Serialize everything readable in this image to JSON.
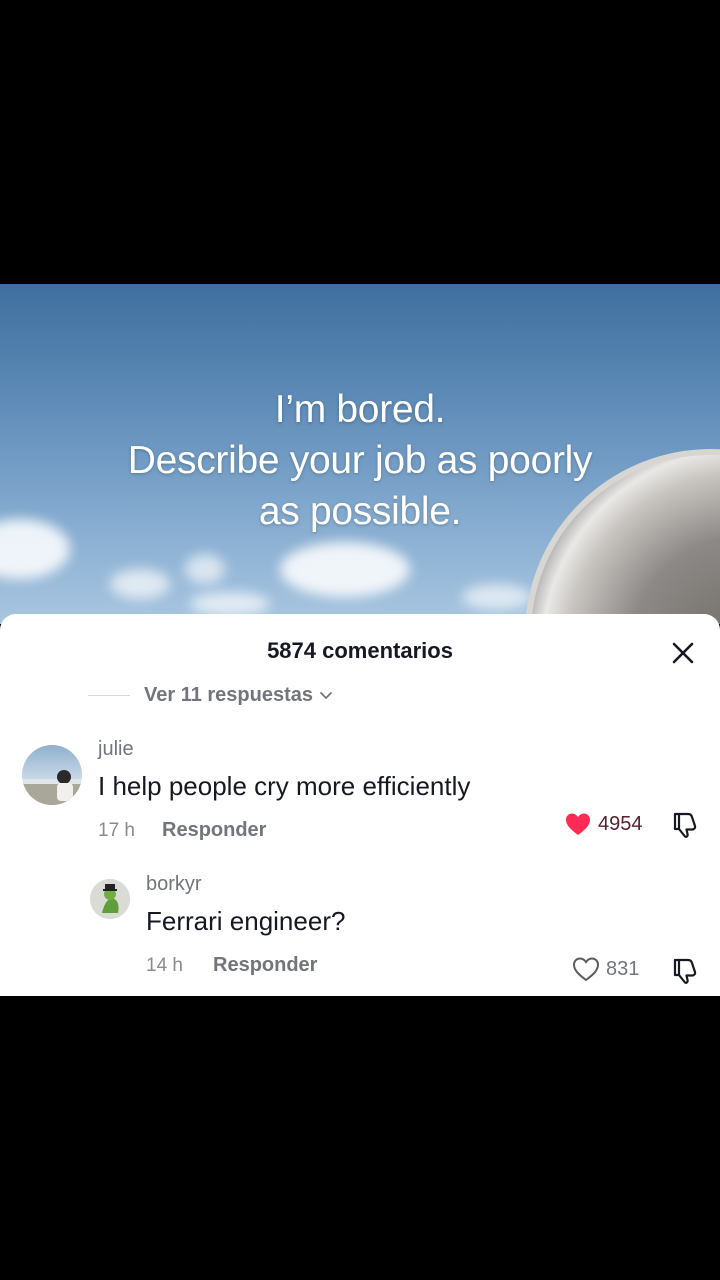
{
  "video": {
    "caption_lines": [
      "I’m bored.",
      "Describe your job as poorly",
      "as possible."
    ]
  },
  "comments_panel": {
    "title": "5874 comentarios",
    "view_replies": "Ver 11 respuestas",
    "comments": [
      {
        "username": "julie",
        "text": "I help people cry more efficiently",
        "time": "17 h",
        "reply_label": "Responder",
        "likes": "4954",
        "liked": true
      },
      {
        "username": "borkyr",
        "text": "Ferrari engineer?",
        "time": "14 h",
        "reply_label": "Responder",
        "likes": "831",
        "liked": false
      }
    ]
  },
  "colors": {
    "like_active": "#fe2c55",
    "text_primary": "#161823",
    "text_secondary": "#73757c"
  },
  "icons": [
    "close-icon",
    "chevron-down-icon",
    "heart-filled-icon",
    "heart-outline-icon",
    "dislike-icon"
  ]
}
